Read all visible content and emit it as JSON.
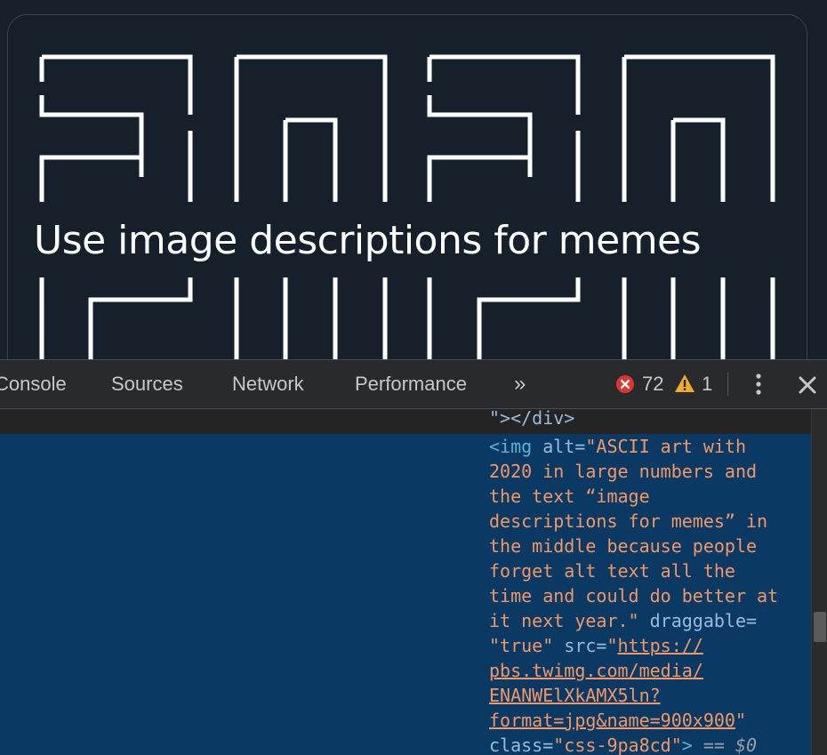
{
  "meme": {
    "caption": "Use image descriptions for memes"
  },
  "devtools": {
    "tabs": {
      "console": "Console",
      "sources": "Sources",
      "network": "Network",
      "performance": "Performance",
      "more": "»"
    },
    "errors": "72",
    "warnings": "1",
    "code": {
      "prev_line": "\"></div>",
      "img_open": "<img ",
      "alt_attr": "alt",
      "alt_eq": "=",
      "alt_value_lines": [
        "\"ASCII art with",
        "2020 in large numbers and",
        "the text “image",
        "descriptions for memes” in",
        "the middle because people",
        "forget alt text all the",
        "time and could do better at",
        "it next year.\""
      ],
      "draggable_attr": " draggable=",
      "draggable_value": "\"true\"",
      "src_attr": " src=",
      "src_quote_open": "\"",
      "src_link_lines": [
        "https://",
        "pbs.twimg.com/media/",
        "ENANWElXkAMX5ln?",
        "format=jpg&name=900x900"
      ],
      "src_quote_close": "\"",
      "class_attr": "class=",
      "class_value": "\"css-9pa8cd\"",
      "tag_close": ">",
      "selected_marker": " == ",
      "selected_var": "$0"
    }
  },
  "colors": {
    "page_bg": "#15202b",
    "devtools_bg": "#242424",
    "selected_bg": "#0a3a63",
    "tag": "#5db0d7",
    "attr_value": "#f29766"
  }
}
